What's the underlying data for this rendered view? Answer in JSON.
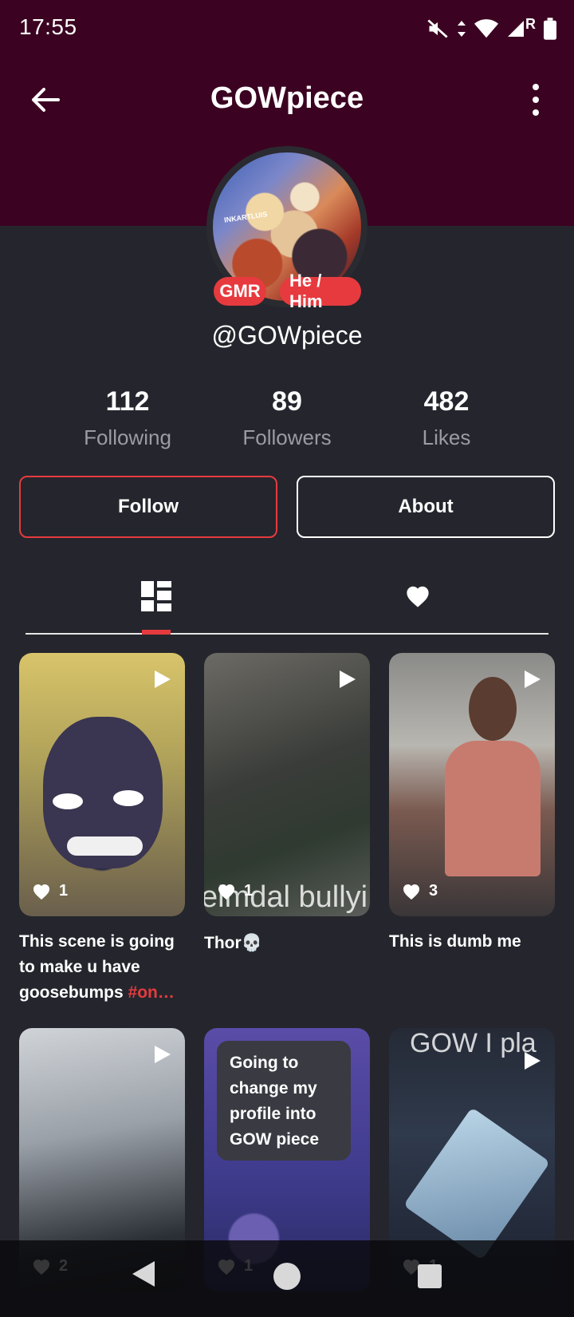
{
  "status_bar": {
    "time": "17:55",
    "roaming_label": "R"
  },
  "header": {
    "title": "GOWpiece"
  },
  "profile": {
    "avatar_text": "INKARTLUIS",
    "badges": [
      "GMR",
      "He / Him"
    ],
    "handle": "@GOWpiece",
    "stats": {
      "following": {
        "value": "112",
        "label": "Following"
      },
      "followers": {
        "value": "89",
        "label": "Followers"
      },
      "likes": {
        "value": "482",
        "label": "Likes"
      }
    }
  },
  "actions": {
    "follow_label": "Follow",
    "about_label": "About"
  },
  "tabs": [
    {
      "icon": "grid-icon",
      "active": true
    },
    {
      "icon": "heart-icon",
      "active": false
    }
  ],
  "videos": [
    {
      "likes": "1",
      "caption": "This scene is going to make u have goosebumps",
      "hashtag": "#on…"
    },
    {
      "likes": "1",
      "caption": "Thor💀",
      "overlay": "eimdal bullyi"
    },
    {
      "likes": "3",
      "caption": "This is dumb me"
    },
    {
      "likes": "2",
      "caption": ""
    },
    {
      "likes": "1",
      "caption": "",
      "bubble": "Going to change my profile into GOW piece"
    },
    {
      "likes": "1",
      "caption": "",
      "overlay": "GOW I pla"
    }
  ],
  "colors": {
    "header_bg": "#3b0321",
    "page_bg": "#25262d",
    "accent": "#e63b3e"
  }
}
